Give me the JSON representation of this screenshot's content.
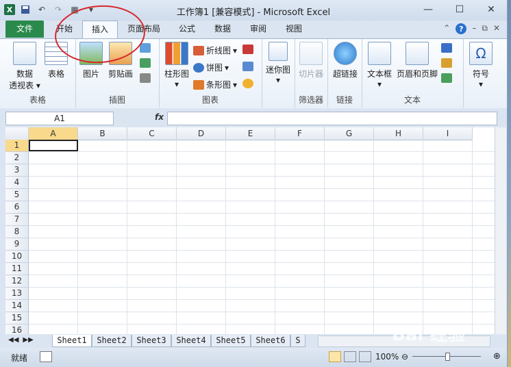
{
  "window": {
    "title": "工作簿1  [兼容模式]  -  Microsoft Excel"
  },
  "tabs": {
    "file": "文件",
    "items": [
      "开始",
      "插入",
      "页面布局",
      "公式",
      "数据",
      "审阅",
      "视图"
    ]
  },
  "ribbon": {
    "tables": {
      "pivot_line1": "数据",
      "pivot_line2": "透视表",
      "table": "表格",
      "group": "表格"
    },
    "illustrations": {
      "picture": "图片",
      "clipart": "剪贴画",
      "group": "插图"
    },
    "charts": {
      "column": "柱形图",
      "line": "折线图",
      "pie": "饼图",
      "bar": "条形图",
      "group": "图表"
    },
    "sparklines": {
      "label": "迷你图"
    },
    "filter": {
      "slicer": "切片器",
      "group": "筛选器"
    },
    "links": {
      "hyperlink": "超链接",
      "group": "链接"
    },
    "text": {
      "textbox": "文本框",
      "header_footer": "页眉和页脚",
      "group": "文本"
    },
    "symbols": {
      "symbol": "符号"
    }
  },
  "formula_bar": {
    "name_box": "A1",
    "fx": "fx",
    "value": ""
  },
  "grid": {
    "columns": [
      "A",
      "B",
      "C",
      "D",
      "E",
      "F",
      "G",
      "H",
      "I"
    ],
    "rows": [
      "1",
      "2",
      "3",
      "4",
      "5",
      "6",
      "7",
      "8",
      "9",
      "10",
      "11",
      "12",
      "13",
      "14",
      "15",
      "16"
    ],
    "active_cell": "A1"
  },
  "sheets": [
    "Sheet1",
    "Sheet2",
    "Sheet3",
    "Sheet4",
    "Sheet5",
    "Sheet6",
    "S"
  ],
  "status": {
    "ready": "就绪",
    "zoom": "100%"
  },
  "watermark": {
    "text": "Bai 经验"
  },
  "colors": {
    "file_tab": "#2a8a4b",
    "annotation": "#d9262b",
    "selected_header": "#f9d98b"
  }
}
